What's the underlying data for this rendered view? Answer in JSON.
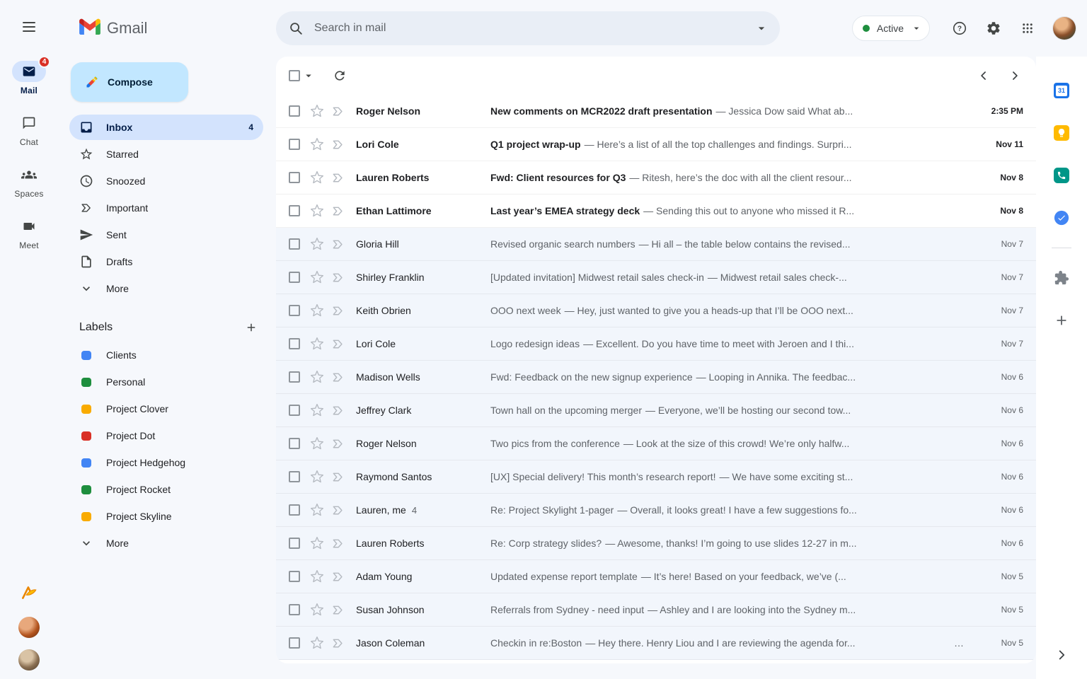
{
  "app": {
    "name": "Gmail"
  },
  "colors": {
    "app_background": "#f6f8fc",
    "compose_button": "#c2e7ff",
    "selected_item": "#d3e3fd",
    "unread_row": "#ffffff",
    "read_row": "#f2f6fc",
    "badge_red": "#d93025",
    "status_dot_green": "#1e8e3e"
  },
  "left_rail": {
    "items": [
      {
        "label": "Mail",
        "badge": "4",
        "active": true
      },
      {
        "label": "Chat",
        "active": false
      },
      {
        "label": "Spaces",
        "active": false
      },
      {
        "label": "Meet",
        "active": false
      }
    ]
  },
  "sidebar": {
    "compose_label": "Compose",
    "items": [
      {
        "label": "Inbox",
        "count": "4",
        "active": true
      },
      {
        "label": "Starred"
      },
      {
        "label": "Snoozed"
      },
      {
        "label": "Important"
      },
      {
        "label": "Sent"
      },
      {
        "label": "Drafts"
      },
      {
        "label": "More"
      }
    ],
    "labels_title": "Labels",
    "labels": [
      {
        "label": "Clients",
        "color": "#4285f4"
      },
      {
        "label": "Personal",
        "color": "#1e8e3e"
      },
      {
        "label": "Project Clover",
        "color": "#f9ab00"
      },
      {
        "label": "Project Dot",
        "color": "#d93025"
      },
      {
        "label": "Project Hedgehog",
        "color": "#4285f4"
      },
      {
        "label": "Project Rocket",
        "color": "#1e8e3e"
      },
      {
        "label": "Project Skyline",
        "color": "#f9ab00"
      }
    ],
    "labels_more": "More"
  },
  "topbar": {
    "search_placeholder": "Search in mail",
    "status_label": "Active"
  },
  "right_rail": {
    "calendar_day": "31"
  },
  "emails": [
    {
      "from": "Roger Nelson",
      "subject": "New comments on MCR2022 draft presentation",
      "snippet": "— Jessica Dow said What ab...",
      "date": "2:35 PM",
      "unread": true
    },
    {
      "from": "Lori Cole",
      "subject": "Q1 project wrap-up",
      "snippet": "— Here’s a list of all the top challenges and findings. Surpri...",
      "date": "Nov 11",
      "unread": true
    },
    {
      "from": "Lauren Roberts",
      "subject": "Fwd: Client resources for Q3",
      "snippet": "— Ritesh, here’s the doc with all the client resour...",
      "date": "Nov 8",
      "unread": true
    },
    {
      "from": "Ethan Lattimore",
      "subject": "Last year’s EMEA strategy deck",
      "snippet": "— Sending this out to anyone who missed it R...",
      "date": "Nov 8",
      "unread": true
    },
    {
      "from": "Gloria Hill",
      "subject": "Revised organic search numbers",
      "snippet": "— Hi all – the table below contains the revised...",
      "date": "Nov 7",
      "unread": false
    },
    {
      "from": "Shirley Franklin",
      "subject": "[Updated invitation] Midwest retail sales check-in",
      "snippet": "— Midwest retail sales check-...",
      "date": "Nov 7",
      "unread": false
    },
    {
      "from": "Keith Obrien",
      "subject": "OOO next week",
      "snippet": "— Hey, just wanted to give you a heads-up that I’ll be OOO next...",
      "date": "Nov 7",
      "unread": false
    },
    {
      "from": "Lori Cole",
      "subject": "Logo redesign ideas",
      "snippet": "— Excellent. Do you have time to meet with Jeroen and I thi...",
      "date": "Nov 7",
      "unread": false
    },
    {
      "from": "Madison Wells",
      "subject": "Fwd: Feedback on the new signup experience",
      "snippet": "— Looping in Annika. The feedbac...",
      "date": "Nov 6",
      "unread": false
    },
    {
      "from": "Jeffrey Clark",
      "subject": "Town hall on the upcoming merger",
      "snippet": "— Everyone, we’ll be hosting our second tow...",
      "date": "Nov 6",
      "unread": false
    },
    {
      "from": "Roger Nelson",
      "subject": "Two pics from the conference",
      "snippet": "— Look at the size of this crowd! We’re only halfw...",
      "date": "Nov 6",
      "unread": false
    },
    {
      "from": "Raymond Santos",
      "subject": "[UX] Special delivery! This month’s research report!",
      "snippet": "— We have some exciting st...",
      "date": "Nov 6",
      "unread": false
    },
    {
      "from": "Lauren, me",
      "thread_count": "4",
      "subject": "Re: Project Skylight 1-pager",
      "snippet": "— Overall, it looks great! I have a few suggestions fo...",
      "date": "Nov 6",
      "unread": false
    },
    {
      "from": "Lauren Roberts",
      "subject": "Re: Corp strategy slides?",
      "snippet": "— Awesome, thanks! I’m going to use slides 12-27 in m...",
      "date": "Nov 6",
      "unread": false
    },
    {
      "from": "Adam Young",
      "subject": "Updated expense report template",
      "snippet": "— It’s here! Based on your feedback, we’ve (...",
      "date": "Nov 5",
      "unread": false
    },
    {
      "from": "Susan Johnson",
      "subject": "Referrals from Sydney - need input",
      "snippet": "— Ashley and I are looking into the Sydney m...",
      "date": "Nov 5",
      "unread": false
    },
    {
      "from": "Jason Coleman",
      "subject": "Checkin in re:Boston",
      "snippet": "— Hey there. Henry Liou and I are reviewing the agenda for...",
      "date": "Nov 5",
      "unread": false,
      "pre_date": "…"
    }
  ]
}
